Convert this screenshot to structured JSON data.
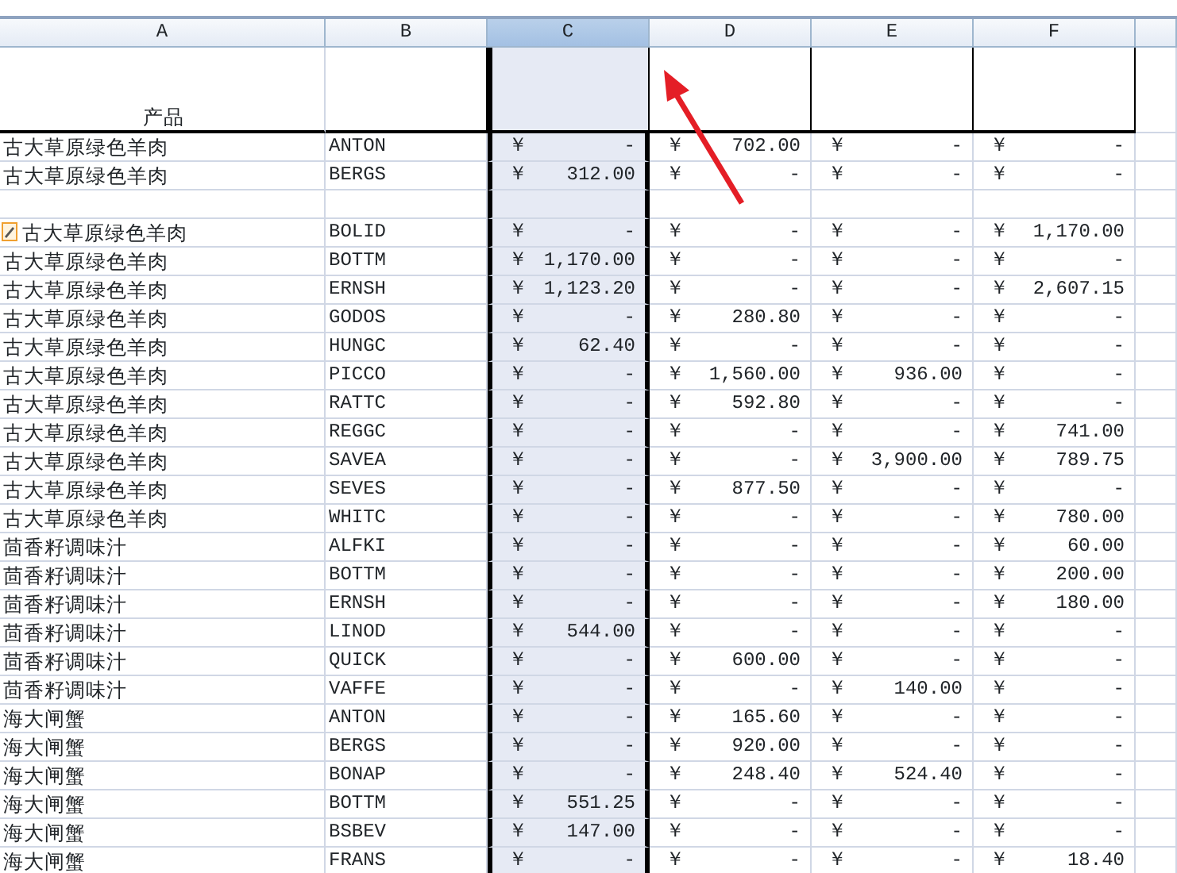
{
  "columns": [
    {
      "letter": "A",
      "selected": false
    },
    {
      "letter": "B",
      "selected": false
    },
    {
      "letter": "C",
      "selected": true
    },
    {
      "letter": "D",
      "selected": false
    },
    {
      "letter": "E",
      "selected": false
    },
    {
      "letter": "F",
      "selected": false
    },
    {
      "selected": false
    }
  ],
  "header_row": {
    "product_heading": "产品"
  },
  "rows": [
    {
      "kind": "data",
      "product": "古大草原绿色羊肉",
      "customer": "ANTON",
      "amounts": [
        [
          "￥",
          "-"
        ],
        [
          "￥",
          "702.00"
        ],
        [
          "￥",
          "-"
        ],
        [
          "￥",
          "-"
        ]
      ]
    },
    {
      "kind": "data",
      "product": "古大草原绿色羊肉",
      "customer": "BERGS",
      "amounts": [
        [
          "￥",
          "312.00"
        ],
        [
          "￥",
          "-"
        ],
        [
          "￥",
          "-"
        ],
        [
          "￥",
          "-"
        ]
      ]
    },
    {
      "kind": "blank"
    },
    {
      "kind": "data",
      "smart_tag": true,
      "product": "古大草原绿色羊肉",
      "customer": "BOLID",
      "amounts": [
        [
          "￥",
          "-"
        ],
        [
          "￥",
          "-"
        ],
        [
          "￥",
          "-"
        ],
        [
          "￥",
          "1,170.00"
        ]
      ]
    },
    {
      "kind": "data",
      "product": "古大草原绿色羊肉",
      "customer": "BOTTM",
      "amounts": [
        [
          "￥",
          "1,170.00"
        ],
        [
          "￥",
          "-"
        ],
        [
          "￥",
          "-"
        ],
        [
          "￥",
          "-"
        ]
      ]
    },
    {
      "kind": "data",
      "product": "古大草原绿色羊肉",
      "customer": "ERNSH",
      "amounts": [
        [
          "￥",
          "1,123.20"
        ],
        [
          "￥",
          "-"
        ],
        [
          "￥",
          "-"
        ],
        [
          "￥",
          "2,607.15"
        ]
      ]
    },
    {
      "kind": "data",
      "product": "古大草原绿色羊肉",
      "customer": "GODOS",
      "amounts": [
        [
          "￥",
          "-"
        ],
        [
          "￥",
          "280.80"
        ],
        [
          "￥",
          "-"
        ],
        [
          "￥",
          "-"
        ]
      ]
    },
    {
      "kind": "data",
      "product": "古大草原绿色羊肉",
      "customer": "HUNGC",
      "amounts": [
        [
          "￥",
          "62.40"
        ],
        [
          "￥",
          "-"
        ],
        [
          "￥",
          "-"
        ],
        [
          "￥",
          "-"
        ]
      ]
    },
    {
      "kind": "data",
      "product": "古大草原绿色羊肉",
      "customer": "PICCO",
      "amounts": [
        [
          "￥",
          "-"
        ],
        [
          "￥",
          "1,560.00"
        ],
        [
          "￥",
          "936.00"
        ],
        [
          "￥",
          "-"
        ]
      ]
    },
    {
      "kind": "data",
      "product": "古大草原绿色羊肉",
      "customer": "RATTC",
      "amounts": [
        [
          "￥",
          "-"
        ],
        [
          "￥",
          "592.80"
        ],
        [
          "￥",
          "-"
        ],
        [
          "￥",
          "-"
        ]
      ]
    },
    {
      "kind": "data",
      "product": "古大草原绿色羊肉",
      "customer": "REGGC",
      "amounts": [
        [
          "￥",
          "-"
        ],
        [
          "￥",
          "-"
        ],
        [
          "￥",
          "-"
        ],
        [
          "￥",
          "741.00"
        ]
      ]
    },
    {
      "kind": "data",
      "product": "古大草原绿色羊肉",
      "customer": "SAVEA",
      "amounts": [
        [
          "￥",
          "-"
        ],
        [
          "￥",
          "-"
        ],
        [
          "￥",
          "3,900.00"
        ],
        [
          "￥",
          "789.75"
        ]
      ]
    },
    {
      "kind": "data",
      "product": "古大草原绿色羊肉",
      "customer": "SEVES",
      "amounts": [
        [
          "￥",
          "-"
        ],
        [
          "￥",
          "877.50"
        ],
        [
          "￥",
          "-"
        ],
        [
          "￥",
          "-"
        ]
      ]
    },
    {
      "kind": "data",
      "product": "古大草原绿色羊肉",
      "customer": "WHITC",
      "amounts": [
        [
          "￥",
          "-"
        ],
        [
          "￥",
          "-"
        ],
        [
          "￥",
          "-"
        ],
        [
          "￥",
          "780.00"
        ]
      ]
    },
    {
      "kind": "data",
      "product": "茴香籽调味汁",
      "customer": "ALFKI",
      "amounts": [
        [
          "￥",
          "-"
        ],
        [
          "￥",
          "-"
        ],
        [
          "￥",
          "-"
        ],
        [
          "￥",
          "60.00"
        ]
      ]
    },
    {
      "kind": "data",
      "product": "茴香籽调味汁",
      "customer": "BOTTM",
      "amounts": [
        [
          "￥",
          "-"
        ],
        [
          "￥",
          "-"
        ],
        [
          "￥",
          "-"
        ],
        [
          "￥",
          "200.00"
        ]
      ]
    },
    {
      "kind": "data",
      "product": "茴香籽调味汁",
      "customer": "ERNSH",
      "amounts": [
        [
          "￥",
          "-"
        ],
        [
          "￥",
          "-"
        ],
        [
          "￥",
          "-"
        ],
        [
          "￥",
          "180.00"
        ]
      ]
    },
    {
      "kind": "data",
      "product": "茴香籽调味汁",
      "customer": "LINOD",
      "amounts": [
        [
          "￥",
          "544.00"
        ],
        [
          "￥",
          "-"
        ],
        [
          "￥",
          "-"
        ],
        [
          "￥",
          "-"
        ]
      ]
    },
    {
      "kind": "data",
      "product": "茴香籽调味汁",
      "customer": "QUICK",
      "amounts": [
        [
          "￥",
          "-"
        ],
        [
          "￥",
          "600.00"
        ],
        [
          "￥",
          "-"
        ],
        [
          "￥",
          "-"
        ]
      ]
    },
    {
      "kind": "data",
      "product": "茴香籽调味汁",
      "customer": "VAFFE",
      "amounts": [
        [
          "￥",
          "-"
        ],
        [
          "￥",
          "-"
        ],
        [
          "￥",
          "140.00"
        ],
        [
          "￥",
          "-"
        ]
      ]
    },
    {
      "kind": "data",
      "product": "海大闸蟹",
      "customer": "ANTON",
      "amounts": [
        [
          "￥",
          "-"
        ],
        [
          "￥",
          "165.60"
        ],
        [
          "￥",
          "-"
        ],
        [
          "￥",
          "-"
        ]
      ]
    },
    {
      "kind": "data",
      "product": "海大闸蟹",
      "customer": "BERGS",
      "amounts": [
        [
          "￥",
          "-"
        ],
        [
          "￥",
          "920.00"
        ],
        [
          "￥",
          "-"
        ],
        [
          "￥",
          "-"
        ]
      ]
    },
    {
      "kind": "data",
      "product": "海大闸蟹",
      "customer": "BONAP",
      "amounts": [
        [
          "￥",
          "-"
        ],
        [
          "￥",
          "248.40"
        ],
        [
          "￥",
          "524.40"
        ],
        [
          "￥",
          "-"
        ]
      ]
    },
    {
      "kind": "data",
      "product": "海大闸蟹",
      "customer": "BOTTM",
      "amounts": [
        [
          "￥",
          "551.25"
        ],
        [
          "￥",
          "-"
        ],
        [
          "￥",
          "-"
        ],
        [
          "￥",
          "-"
        ]
      ]
    },
    {
      "kind": "data",
      "product": "海大闸蟹",
      "customer": "BSBEV",
      "amounts": [
        [
          "￥",
          "147.00"
        ],
        [
          "￥",
          "-"
        ],
        [
          "￥",
          "-"
        ],
        [
          "￥",
          "-"
        ]
      ]
    },
    {
      "kind": "data",
      "product": "海大闸蟹",
      "customer": "FRANS",
      "amounts": [
        [
          "￥",
          "-"
        ],
        [
          "￥",
          "-"
        ],
        [
          "￥",
          "-"
        ],
        [
          "￥",
          "18.40"
        ]
      ]
    }
  ]
}
